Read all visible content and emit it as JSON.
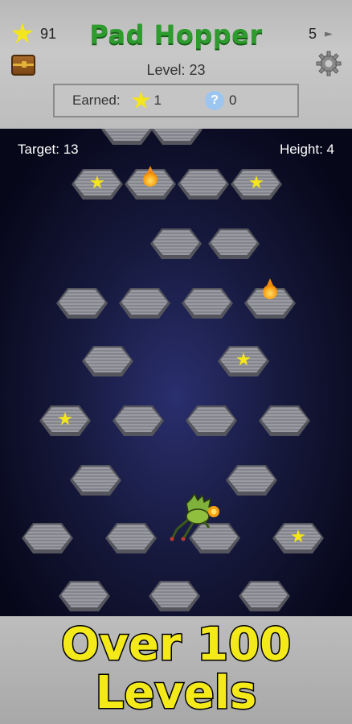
{
  "header": {
    "stars_total": "91",
    "title": "Pad Hopper",
    "hints_total": "5",
    "level_text": "Level: 23",
    "earned_label": "Earned:",
    "earned_stars": "1",
    "earned_hints": "0"
  },
  "hud": {
    "target_text": "Target: 13",
    "height_text": "Height: 4"
  },
  "banner": {
    "line1": "Over 100",
    "line2": "Levels"
  },
  "icons": [
    "star-icon",
    "treasure-chest-icon",
    "settings-gear-icon",
    "hint-question-icon",
    "fireball-icon",
    "frog-icon",
    "hint-arrow-icon"
  ],
  "colors": {
    "title_green": "#2e9b2e",
    "star_yellow": "#f4e51c",
    "banner_yellow": "#f5ea19"
  }
}
